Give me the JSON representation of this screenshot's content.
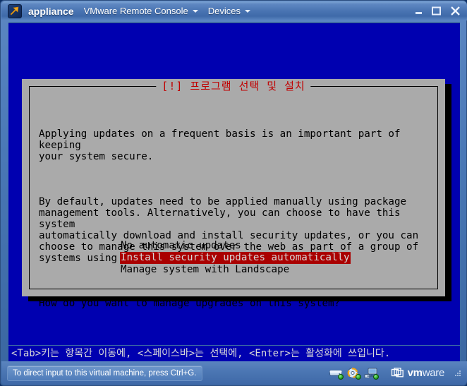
{
  "window": {
    "app_icon": "vmware-appliance-icon",
    "title": "appliance",
    "menus": [
      {
        "label": "VMware Remote Console",
        "icon": "chevron-down-icon"
      },
      {
        "label": "Devices",
        "icon": "chevron-down-icon"
      }
    ],
    "controls": {
      "minimize": "minimize-icon",
      "maximize": "maximize-icon",
      "close": "close-icon"
    }
  },
  "vm_screen": {
    "background_color": "#0000b0",
    "dialog": {
      "title": "[!] 프로그램 선택 및 설치",
      "title_color": "#c00000",
      "background_color": "#aaaaaa",
      "paragraphs": [
        "Applying updates on a frequent basis is an important part of keeping\nyour system secure.",
        "By default, updates need to be applied manually using package\nmanagement tools. Alternatively, you can choose to have this system\nautomatically download and install security updates, or you can\nchoose to manage this system over the web as part of a group of\nsystems using Canonical's Landscape service.",
        "How do you want to manage upgrades on this system?"
      ],
      "options": [
        {
          "label": "No automatic updates",
          "selected": false
        },
        {
          "label": "Install security updates automatically",
          "selected": true
        },
        {
          "label": "Manage system with Landscape",
          "selected": false
        }
      ],
      "selected_index": 1,
      "highlight_color": "#aa0000"
    },
    "help_line": "<Tab>키는 항목간 이동에, <스페이스바>는 선택에, <Enter>는 활성화에 쓰입니다."
  },
  "statusbar": {
    "message": "To direct input to this virtual machine, press Ctrl+G.",
    "devices": [
      {
        "name": "hard-disk-icon",
        "connected": true
      },
      {
        "name": "cd-dvd-icon",
        "connected": true
      },
      {
        "name": "network-adapter-icon",
        "connected": true
      }
    ],
    "brand": {
      "icon": "vmware-logo-icon",
      "bold_text": "vm",
      "light_text": "ware",
      "trademark": "®"
    },
    "resize_grip": "resize-grip-icon"
  }
}
